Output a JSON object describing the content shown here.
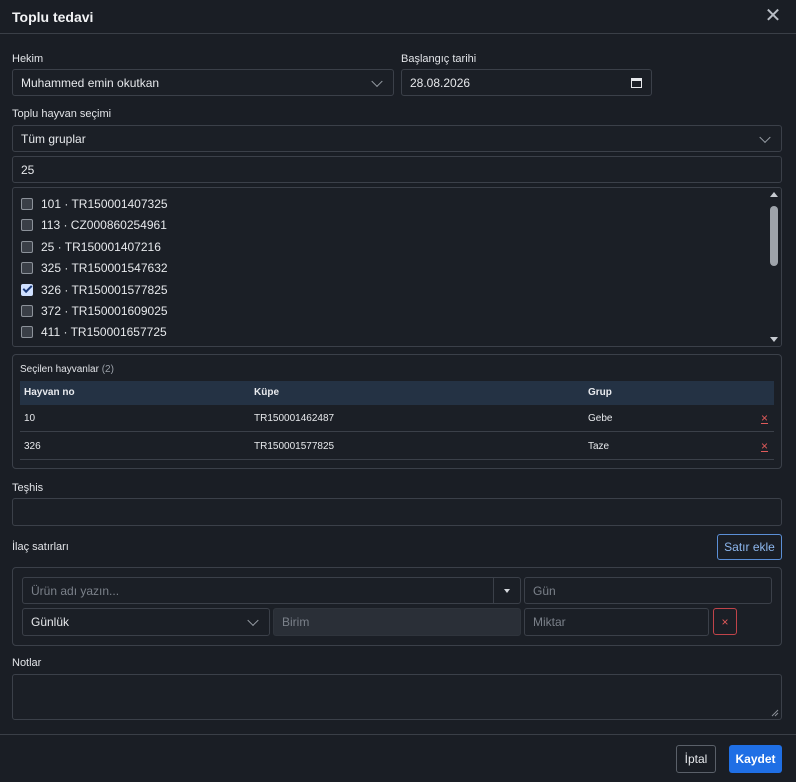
{
  "dialog": {
    "title": "Toplu tedavi"
  },
  "form": {
    "vet_label": "Hekim",
    "vet_value": "Muhammed emin okutkan",
    "start_date_label": "Başlangıç tarihi",
    "start_date_value": "28.08.2026",
    "bulk_label": "Toplu hayvan seçimi",
    "group_value": "Tüm gruplar",
    "search_value": "25"
  },
  "animal_list": [
    {
      "label": "101 · TR150001407325",
      "checked": false
    },
    {
      "label": "113 · CZ000860254961",
      "checked": false
    },
    {
      "label": "25 · TR150001407216",
      "checked": false
    },
    {
      "label": "325 · TR150001547632",
      "checked": false
    },
    {
      "label": "326 · TR150001577825",
      "checked": true
    },
    {
      "label": "372 · TR150001609025",
      "checked": false
    },
    {
      "label": "411 · TR150001657725",
      "checked": false
    }
  ],
  "selected": {
    "title": "Seçilen hayvanlar",
    "count": "(2)",
    "columns": [
      "Hayvan no",
      "Küpe",
      "Grup"
    ],
    "rows": [
      {
        "no": "10",
        "tag": "TR150001462487",
        "group": "Gebe",
        "remove": "×"
      },
      {
        "no": "326",
        "tag": "TR150001577825",
        "group": "Taze",
        "remove": "×"
      }
    ]
  },
  "diagnosis": {
    "label": "Teşhis",
    "value": ""
  },
  "medication": {
    "label": "İlaç satırları",
    "add_button": "Satır ekle",
    "product_placeholder": "Ürün adı yazın...",
    "days_placeholder": "Gün",
    "frequency_value": "Günlük",
    "unit_placeholder": "Birim",
    "amount_placeholder": "Miktar",
    "remove_label": "×"
  },
  "notes": {
    "label": "Notlar",
    "value": ""
  },
  "footer": {
    "cancel_label": "İptal",
    "save_label": "Kaydet"
  },
  "colors": {
    "accent": "#1f6fe5",
    "danger": "#e05a5a",
    "background": "#1a1e25"
  }
}
